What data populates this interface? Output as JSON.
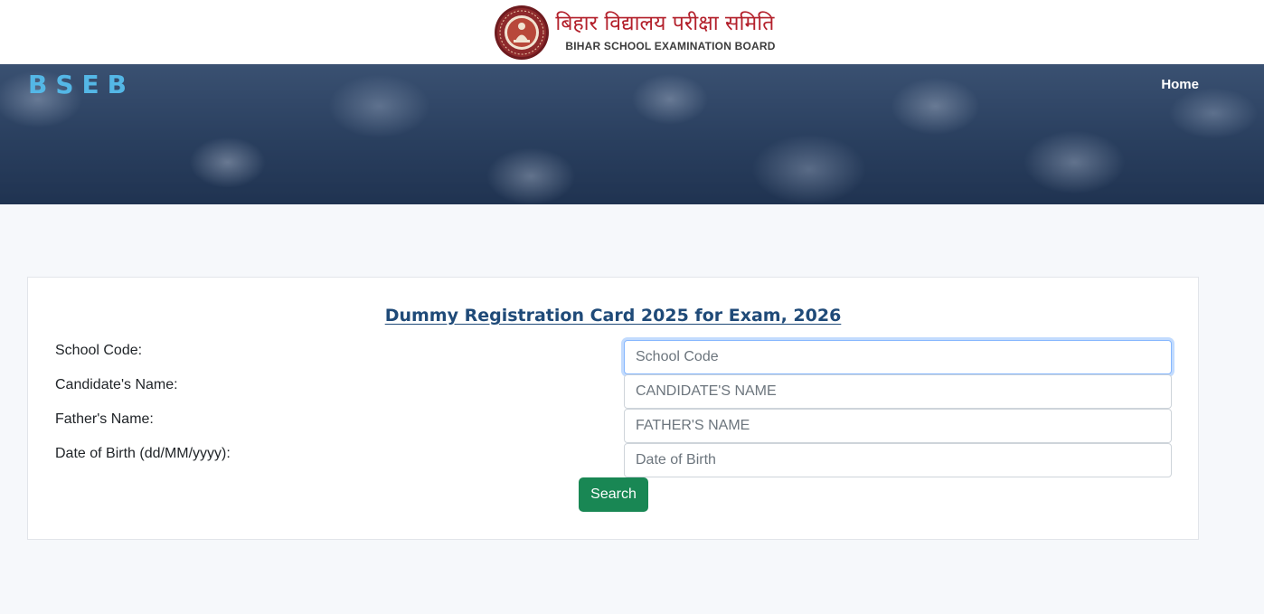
{
  "logo": {
    "hindi_text": "बिहार विद्यालय परीक्षा समिति",
    "english_text": "BIHAR SCHOOL EXAMINATION BOARD",
    "seal_icon": "bseb-seal-icon"
  },
  "nav": {
    "brand": "BSEB",
    "home_label": "Home"
  },
  "form": {
    "title": "Dummy Registration Card 2025 for Exam, 2026",
    "fields": [
      {
        "label": "School Code:",
        "placeholder": "School Code",
        "value": ""
      },
      {
        "label": "Candidate's Name:",
        "placeholder": "CANDIDATE'S NAME",
        "value": ""
      },
      {
        "label": "Father's Name:",
        "placeholder": "FATHER'S NAME",
        "value": ""
      },
      {
        "label": "Date of Birth (dd/MM/yyyy):",
        "placeholder": "Date of Birth",
        "value": ""
      }
    ],
    "search_label": "Search"
  },
  "colors": {
    "brand_blue": "#54b7e6",
    "title_blue": "#1f4a78",
    "button_green": "#198754",
    "seal_red": "#b3202b"
  }
}
